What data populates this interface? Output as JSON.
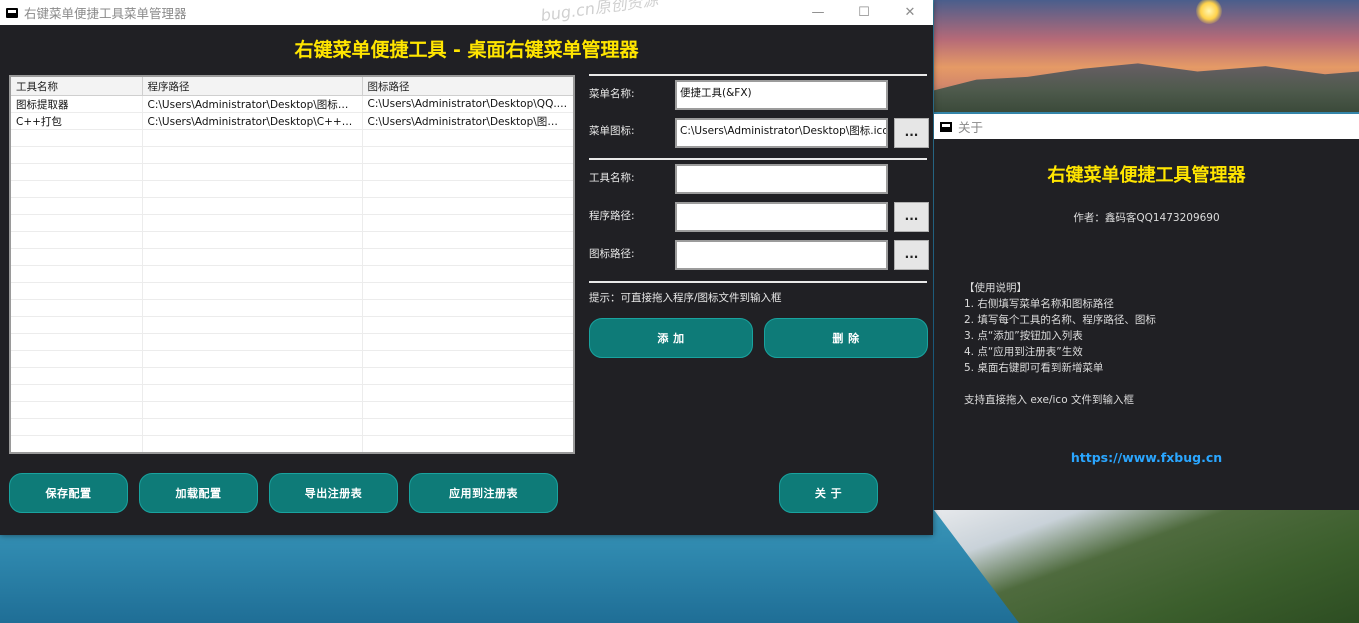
{
  "main_window": {
    "title": "右键菜单便捷工具菜单管理器",
    "headline": "右键菜单便捷工具 - 桌面右键菜单管理器",
    "watermark": "bug.cn原创资源",
    "controls": {
      "minimize": "—",
      "maximize": "☐",
      "close": "✕"
    }
  },
  "table": {
    "columns": [
      "工具名称",
      "程序路径",
      "图标路径"
    ],
    "rows": [
      [
        "图标提取器",
        "C:\\Users\\Administrator\\Desktop\\图标提取...",
        "C:\\Users\\Administrator\\Desktop\\QQ.ico"
      ],
      [
        "C++打包",
        "C:\\Users\\Administrator\\Desktop\\C++打包...",
        "C:\\Users\\Administrator\\Desktop\\图标.ico"
      ]
    ]
  },
  "form": {
    "menu_name_label": "菜单名称:",
    "menu_name_value": "便捷工具(&FX)",
    "menu_icon_label": "菜单图标:",
    "menu_icon_value": "C:\\Users\\Administrator\\Desktop\\图标.ico",
    "tool_name_label": "工具名称:",
    "tool_name_value": "",
    "program_path_label": "程序路径:",
    "program_path_value": "",
    "icon_path_label": "图标路径:",
    "icon_path_value": "",
    "browse_label": "...",
    "hint": "提示：可直接拖入程序/图标文件到输入框",
    "add_label": "添 加",
    "delete_label": "删 除"
  },
  "bottom_buttons": {
    "save": "保存配置",
    "load": "加载配置",
    "export": "导出注册表",
    "apply": "应用到注册表",
    "about": "关 于"
  },
  "about_window": {
    "title": "关于",
    "heading": "右键菜单便捷工具管理器",
    "author": "作者：鑫码客QQ1473209690",
    "usage_lines": [
      "【使用说明】",
      "1. 右侧填写菜单名称和图标路径",
      "2. 填写每个工具的名称、程序路径、图标",
      "3. 点“添加”按钮加入列表",
      "4. 点“应用到注册表”生效",
      "5. 桌面右键即可看到新增菜单"
    ],
    "note": "支持直接拖入 exe/ico 文件到输入框",
    "link": "https://www.fxbug.cn"
  },
  "colors": {
    "window_bg": "#202024",
    "title_accent": "#ffe500",
    "button_bg": "#0e7b78",
    "link": "#2aa6ff"
  }
}
